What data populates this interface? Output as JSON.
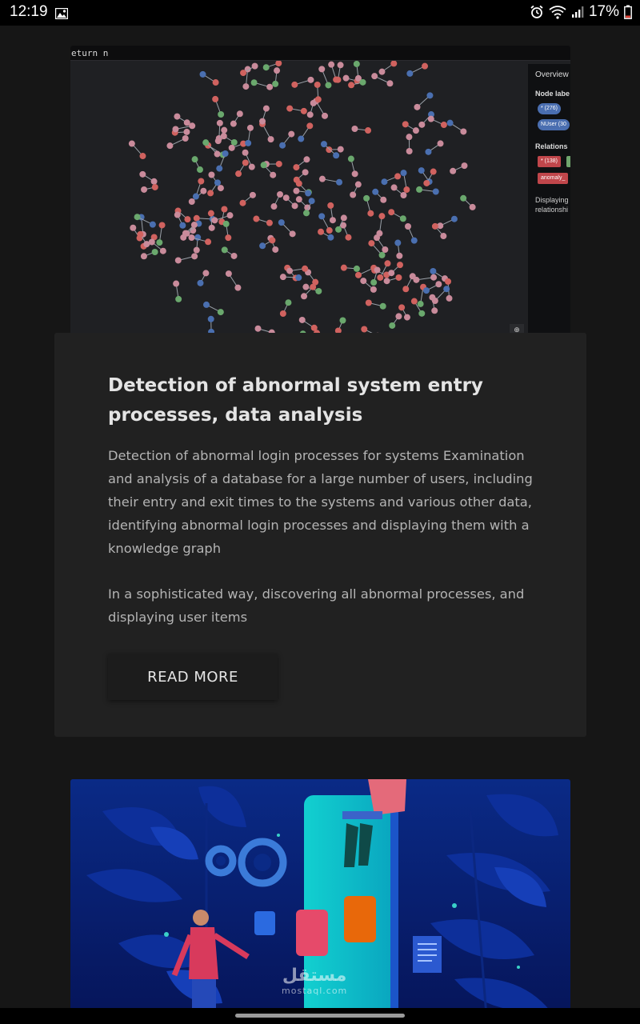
{
  "status_bar": {
    "time": "12:19",
    "battery": "17%",
    "icons": [
      "image-icon",
      "alarm-icon",
      "wifi-icon",
      "signal-icon",
      "battery-icon"
    ]
  },
  "graph_screenshot": {
    "query_text": "eturn n",
    "overview_title": "Overview",
    "node_labels_heading": "Node labe",
    "node_label_pills": [
      "* (276)",
      "NUser (30"
    ],
    "relationship_heading": "Relations",
    "relationship_pills": [
      "* (138)",
      "anomaly_"
    ],
    "displaying_text_1": "Displaying",
    "displaying_text_2": "relationshi",
    "node_colors": {
      "pink": "#c98b9b",
      "red": "#d0625f",
      "blue": "#4a6fb0",
      "green": "#6aa86d"
    }
  },
  "article": {
    "title": "Detection of abnormal system entry processes, data analysis",
    "paragraph_1": "Detection of abnormal login processes for systems Examination and analysis of a database for a large number of users, including their entry and exit times to the systems and various other data, identifying abnormal login processes and displaying them with a knowledge graph",
    "paragraph_2": "In a sophisticated way, discovering all abnormal processes, and displaying user items",
    "read_more_label": "READ MORE"
  },
  "watermark": {
    "arabic": "مستقل",
    "latin": "mostaql.com"
  },
  "colors": {
    "background": "#161616",
    "card": "#212121",
    "illustration_bg": "#0b1f6b",
    "phone": "#10c4c8"
  }
}
